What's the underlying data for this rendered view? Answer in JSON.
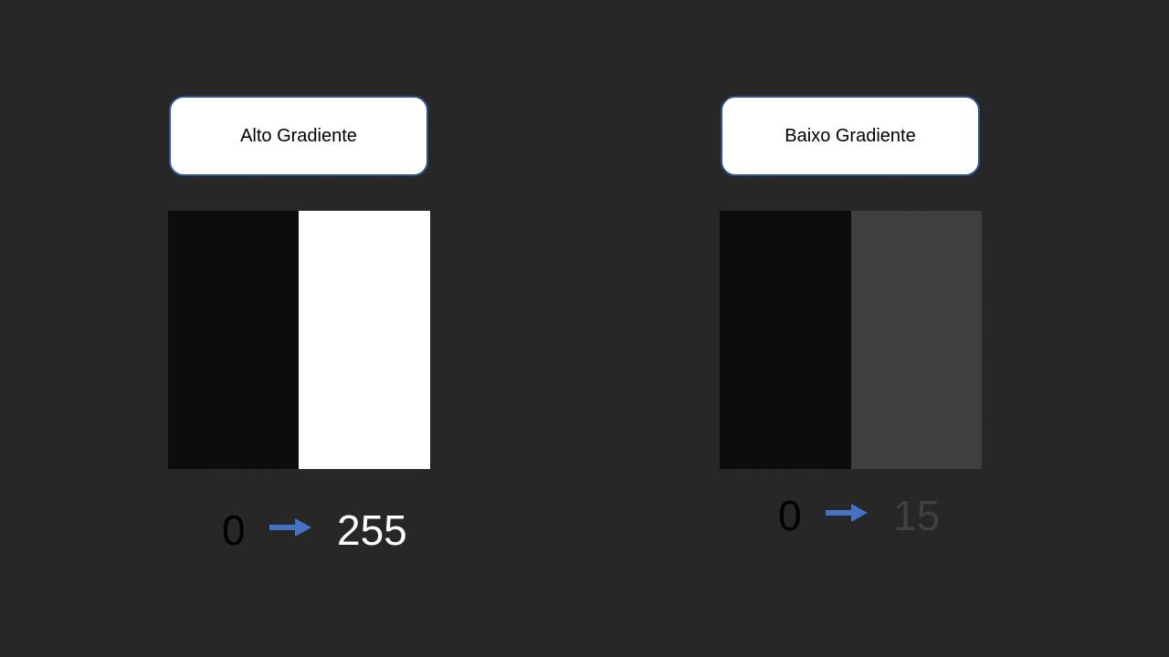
{
  "left_panel": {
    "title": "Alto Gradiente",
    "from_value": "0",
    "to_value": "255",
    "from_color": "#0d0d0d",
    "to_color": "#ffffff"
  },
  "right_panel": {
    "title": "Baixo Gradiente",
    "from_value": "0",
    "to_value": "15",
    "from_color": "#0d0d0d",
    "to_color": "#3f3f3f"
  },
  "colors": {
    "background": "#262626",
    "box_border": "#2f528f",
    "arrow": "#4472c4"
  },
  "icons": {
    "arrow": "arrow-right-icon"
  }
}
